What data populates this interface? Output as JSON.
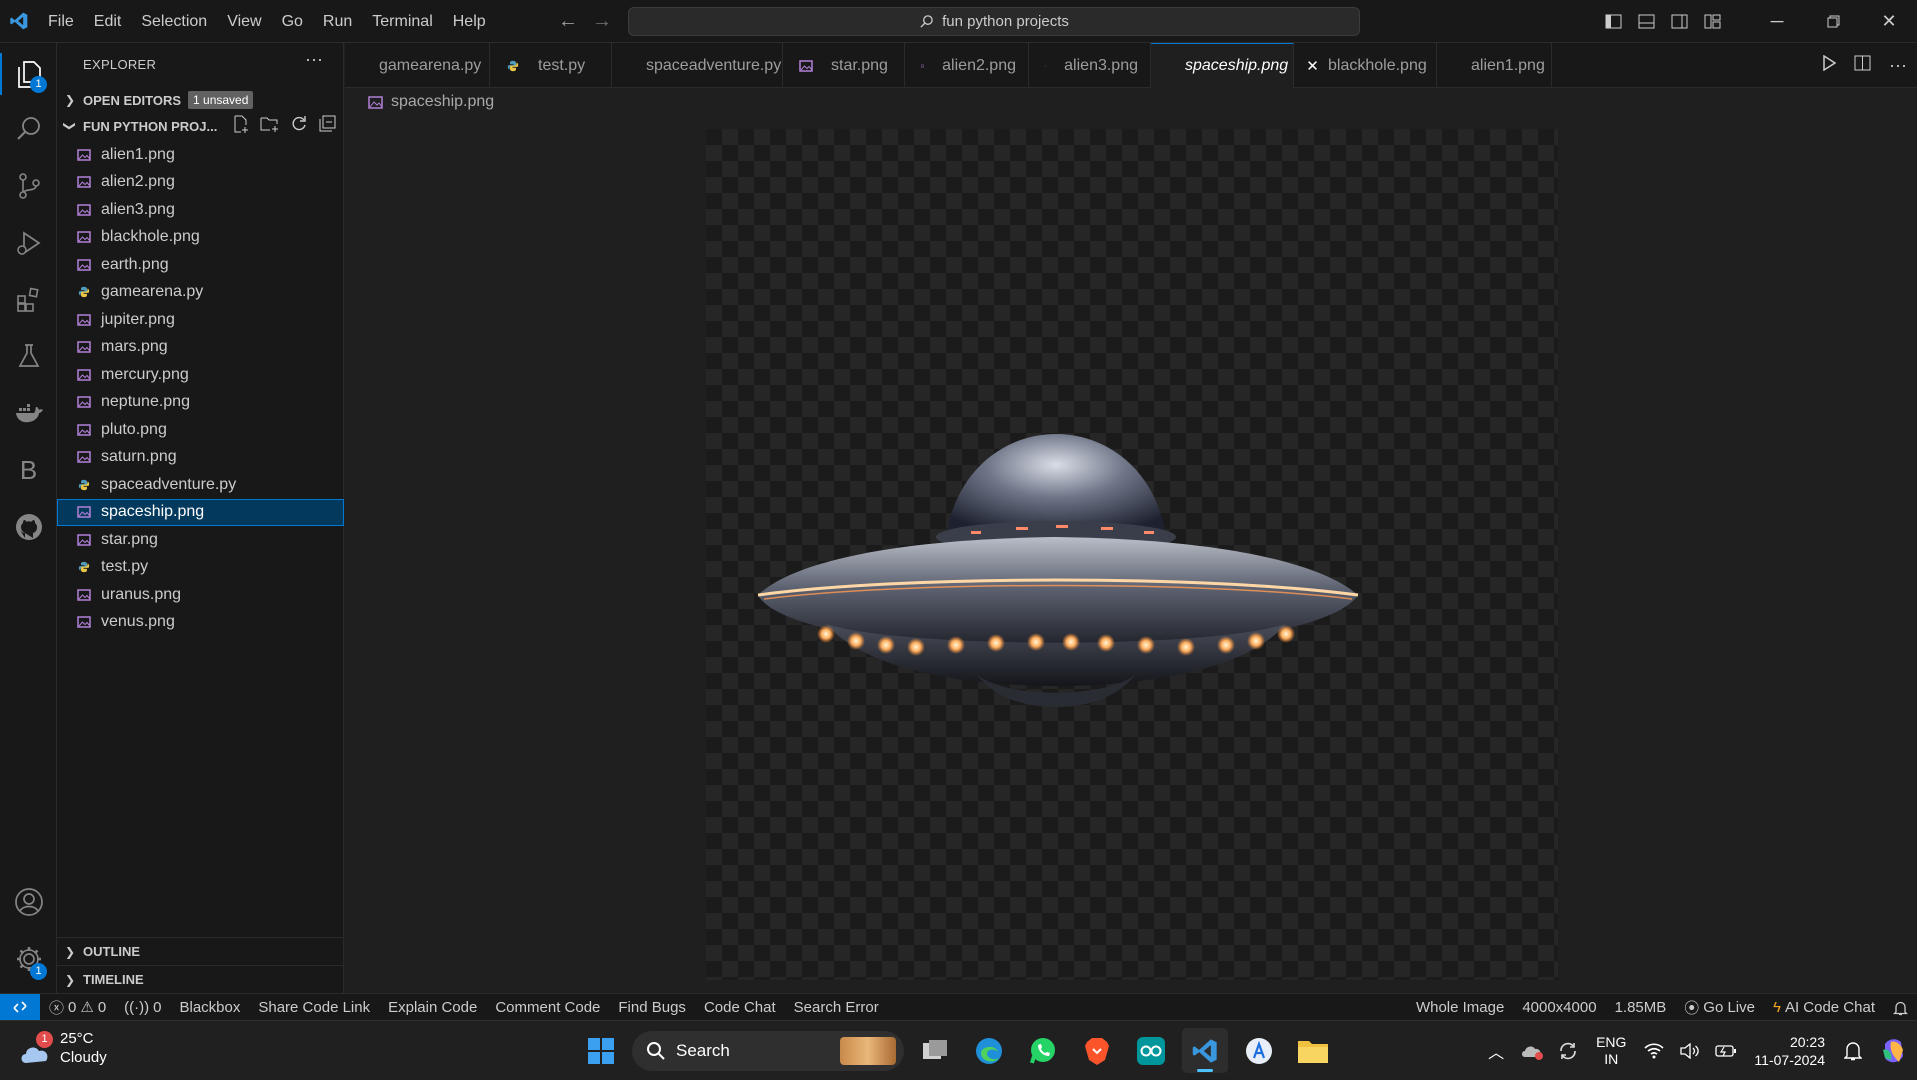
{
  "menu": [
    "File",
    "Edit",
    "Selection",
    "View",
    "Go",
    "Run",
    "Terminal",
    "Help"
  ],
  "search": {
    "text": "fun python projects"
  },
  "activity": {
    "explorer_badge": "1",
    "settings_badge": "1",
    "b_label": "B"
  },
  "sidebar": {
    "title": "EXPLORER",
    "open_editors": "OPEN EDITORS",
    "unsaved": "1 unsaved",
    "folder": "FUN PYTHON PROJ...",
    "files": [
      {
        "name": "alien1.png",
        "type": "png"
      },
      {
        "name": "alien2.png",
        "type": "png"
      },
      {
        "name": "alien3.png",
        "type": "png"
      },
      {
        "name": "blackhole.png",
        "type": "png"
      },
      {
        "name": "earth.png",
        "type": "png"
      },
      {
        "name": "gamearena.py",
        "type": "py"
      },
      {
        "name": "jupiter.png",
        "type": "png"
      },
      {
        "name": "mars.png",
        "type": "png"
      },
      {
        "name": "mercury.png",
        "type": "png"
      },
      {
        "name": "neptune.png",
        "type": "png"
      },
      {
        "name": "pluto.png",
        "type": "png"
      },
      {
        "name": "saturn.png",
        "type": "png"
      },
      {
        "name": "spaceadventure.py",
        "type": "py"
      },
      {
        "name": "spaceship.png",
        "type": "png",
        "selected": true
      },
      {
        "name": "star.png",
        "type": "png"
      },
      {
        "name": "test.py",
        "type": "py"
      },
      {
        "name": "uranus.png",
        "type": "png"
      },
      {
        "name": "venus.png",
        "type": "png"
      }
    ],
    "outline": "OUTLINE",
    "timeline": "TIMELINE"
  },
  "tabs": [
    {
      "label": "gamearena.py",
      "type": "py",
      "dirty": true
    },
    {
      "label": "test.py",
      "type": "py"
    },
    {
      "label": "spaceadventure.py",
      "type": "py"
    },
    {
      "label": "star.png",
      "type": "png"
    },
    {
      "label": "alien2.png",
      "type": "png"
    },
    {
      "label": "alien3.png",
      "type": "png"
    },
    {
      "label": "spaceship.png",
      "type": "png",
      "active": true
    },
    {
      "label": "blackhole.png",
      "type": "png"
    },
    {
      "label": "alien1.png",
      "type": "png"
    }
  ],
  "breadcrumb": "spaceship.png",
  "status": {
    "errors": "0",
    "warnings": "0",
    "ports": "0",
    "items": [
      "Blackbox",
      "Share Code Link",
      "Explain Code",
      "Comment Code",
      "Find Bugs",
      "Code Chat",
      "Search Error"
    ],
    "right": {
      "whole_image": "Whole Image",
      "dimensions": "4000x4000",
      "size": "1.85MB",
      "go_live": "Go Live",
      "ai_chat": "AI Code Chat"
    }
  },
  "taskbar": {
    "temp": "25°C",
    "weather": "Cloudy",
    "weather_badge": "1",
    "search": "Search",
    "lang1": "ENG",
    "lang2": "IN",
    "time": "20:23",
    "date": "11-07-2024"
  },
  "colors": {
    "accent": "#0078d4",
    "png_icon": "#b180d7",
    "py_icon": "#519aba"
  }
}
